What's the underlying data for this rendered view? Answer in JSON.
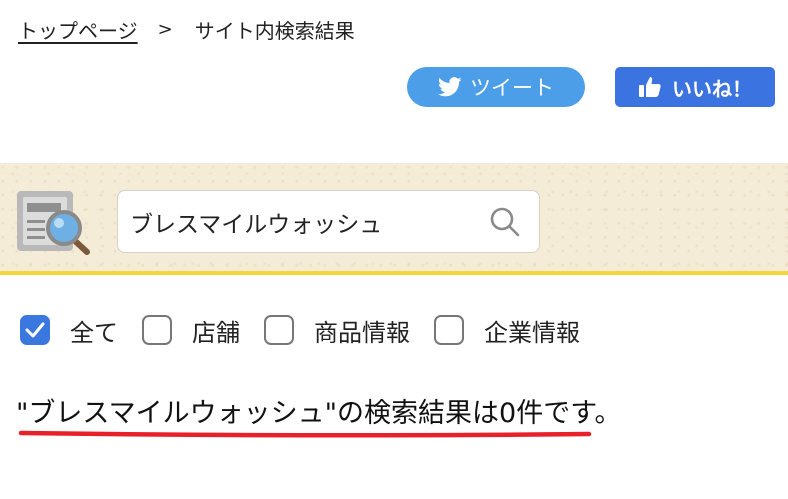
{
  "breadcrumb": {
    "home": "トップページ",
    "separator": ">",
    "current": "サイト内検索結果"
  },
  "social": {
    "tweet_label": "ツイート",
    "like_label": "いいね！",
    "tweet_color": "#4b9ee7",
    "like_color": "#3b73e0"
  },
  "search": {
    "value": "ブレスマイルウォッシュ",
    "band_color": "#f5ecd8",
    "accent_border_color": "#f2d63a"
  },
  "filters": [
    {
      "label": "全て",
      "checked": true
    },
    {
      "label": "店舗",
      "checked": false
    },
    {
      "label": "商品情報",
      "checked": false
    },
    {
      "label": "企業情報",
      "checked": false
    }
  ],
  "result": {
    "message": "\"ブレスマイルウォッシュ\"の検索結果は0件です。",
    "underline_color": "#e8202a"
  }
}
